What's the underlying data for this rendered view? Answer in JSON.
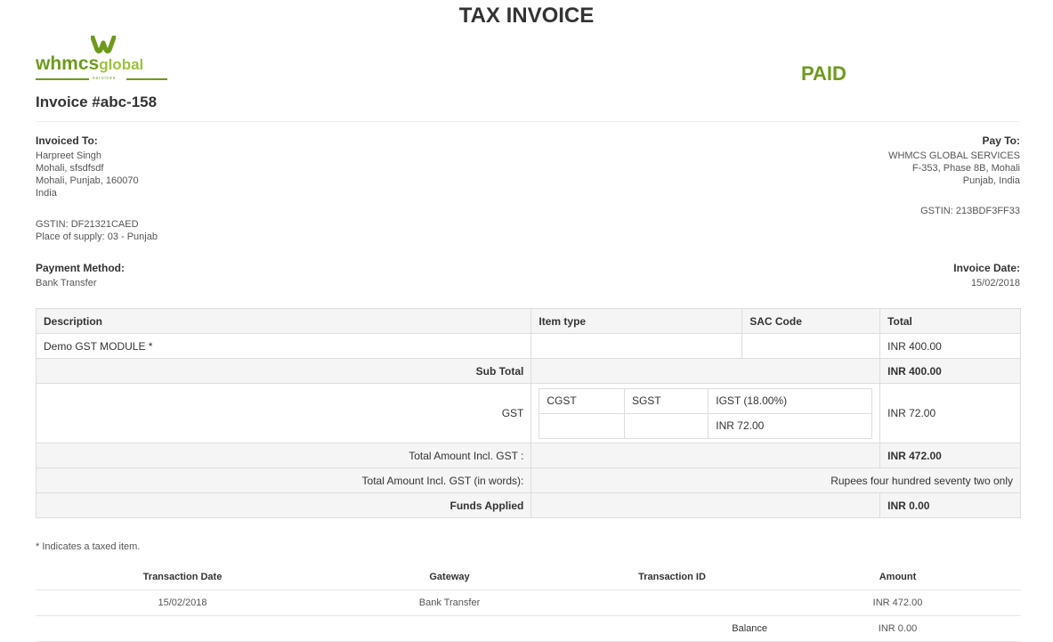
{
  "title": "TAX INVOICE",
  "logo": {
    "brand_main": "whmcs",
    "brand_accent": "global",
    "brand_sub": "services"
  },
  "invoice_number": "Invoice #abc-158",
  "status": "PAID",
  "invoiced_to": {
    "label": "Invoiced To:",
    "lines": [
      "Harpreet Singh",
      "Mohali, sfsdfsdf",
      "Mohali, Punjab, 160070",
      "India"
    ],
    "gstin": "GSTIN: DF21321CAED",
    "place_of_supply": "Place of supply: 03 - Punjab"
  },
  "pay_to": {
    "label": "Pay To:",
    "lines": [
      "WHMCS GLOBAL SERVICES",
      "F-353, Phase 8B, Mohali",
      "Punjab, India"
    ],
    "gstin": "GSTIN: 213BDF3FF33"
  },
  "payment_method": {
    "label": "Payment Method:",
    "value": "Bank Transfer"
  },
  "invoice_date": {
    "label": "Invoice Date:",
    "value": "15/02/2018"
  },
  "items_table": {
    "headers": [
      "Description",
      "Item type",
      "SAC Code",
      "Total"
    ],
    "rows": [
      {
        "description": "Demo GST MODULE *",
        "item_type": "",
        "sac_code": "",
        "total": "INR 400.00"
      }
    ],
    "subtotal_label": "Sub Total",
    "subtotal_value": "INR 400.00",
    "gst_label": "GST",
    "gst_headers": [
      "CGST",
      "SGST",
      "IGST (18.00%)"
    ],
    "gst_values": [
      "",
      "",
      "INR 72.00"
    ],
    "gst_total": "INR 72.00",
    "total_incl_label": "Total Amount Incl. GST :",
    "total_incl_value": "INR 472.00",
    "total_words_label": "Total Amount Incl. GST (in words):",
    "total_words_value": "Rupees four hundred seventy two only",
    "funds_applied_label": "Funds Applied",
    "funds_applied_value": "INR 0.00"
  },
  "taxed_note": "* Indicates a taxed item.",
  "transactions": {
    "headers": [
      "Transaction Date",
      "Gateway",
      "Transaction ID",
      "Amount"
    ],
    "rows": [
      {
        "date": "15/02/2018",
        "gateway": "Bank Transfer",
        "id": "",
        "amount": "INR 472.00"
      }
    ],
    "balance_label": "Balance",
    "balance_value": "INR 0.00"
  },
  "colors": {
    "accent": "#6e9a1c",
    "shade": "#f5f5f5",
    "border": "#dddddd"
  }
}
